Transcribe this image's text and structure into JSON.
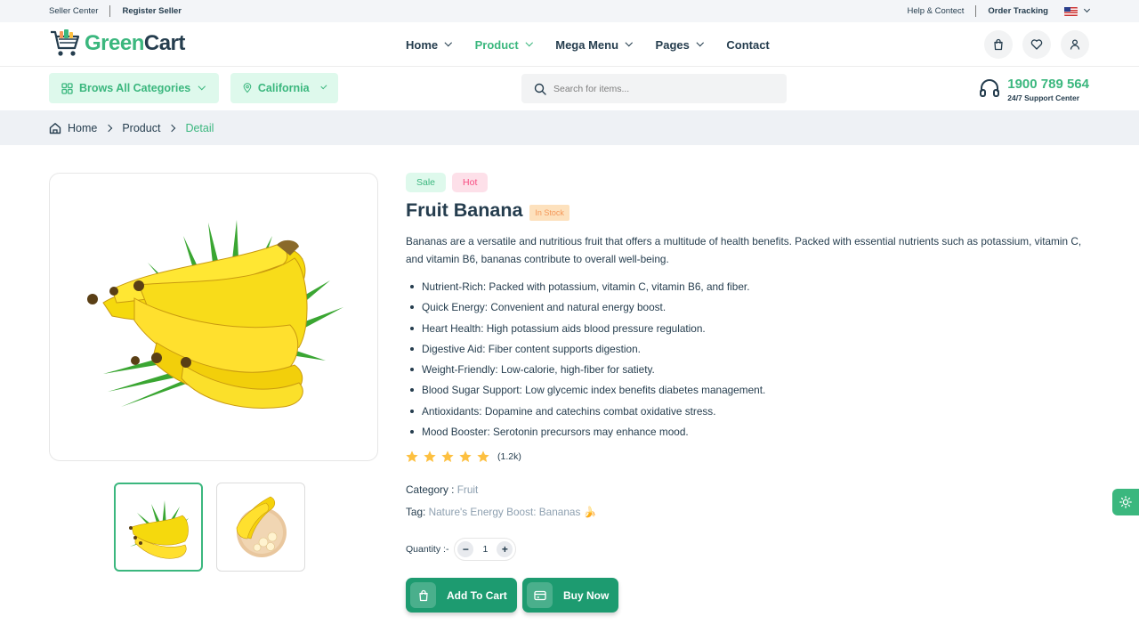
{
  "topbar": {
    "seller_center": "Seller Center",
    "register_seller": "Register Seller",
    "help_contact": "Help & Contect",
    "order_tracking": "Order Tracking",
    "flag_icon": "us-flag-icon"
  },
  "header": {
    "logo_prefix": "Green",
    "logo_suffix": "Cart",
    "nav": [
      {
        "label": "Home",
        "dropdown": true,
        "active": false
      },
      {
        "label": "Product",
        "dropdown": true,
        "active": true
      },
      {
        "label": "Mega Menu",
        "dropdown": true,
        "active": false
      },
      {
        "label": "Pages",
        "dropdown": true,
        "active": false
      },
      {
        "label": "Contact",
        "dropdown": false,
        "active": false
      }
    ],
    "icons": [
      "shopping-bag-icon",
      "heart-icon",
      "user-icon"
    ]
  },
  "toolbar": {
    "categories_label": "Brows All Categories",
    "location_label": "California",
    "search_placeholder": "Search for items...",
    "support_phone": "1900 789 564",
    "support_sub": "24/7 Support Center"
  },
  "breadcrumb": {
    "items": [
      "Home",
      "Product",
      "Detail"
    ]
  },
  "product": {
    "badges": [
      "Sale",
      "Hot"
    ],
    "title": "Fruit Banana",
    "stock_label": "In Stock",
    "description": "Bananas are a versatile and nutritious fruit that offers a multitude of health benefits. Packed with essential nutrients such as potassium, vitamin C, and vitamin B6, bananas contribute to overall well-being.",
    "features": [
      "Nutrient-Rich: Packed with potassium, vitamin C, vitamin B6, and fiber.",
      "Quick Energy: Convenient and natural energy boost.",
      "Heart Health: High potassium aids blood pressure regulation.",
      "Digestive Aid: Fiber content supports digestion.",
      "Weight-Friendly: Low-calorie, high-fiber for satiety.",
      "Blood Sugar Support: Low glycemic index benefits diabetes management.",
      "Antioxidants: Dopamine and catechins combat oxidative stress.",
      "Mood Booster: Serotonin precursors may enhance mood."
    ],
    "rating_stars": 5,
    "rating_count": "(1.2k)",
    "category_label": "Category :",
    "category_value": "Fruit",
    "tag_label": "Tag:",
    "tag_value": "Nature's Energy Boost: Bananas 🍌",
    "quantity_label": "Quantity :-",
    "quantity_value": "1",
    "add_to_cart_label": "Add To Cart",
    "buy_now_label": "Buy Now"
  },
  "colors": {
    "brand_green": "#3bb77e",
    "button_green": "#1d9b70",
    "text_dark": "#253d4e",
    "star": "#fdc040",
    "hot": "#f74b81"
  }
}
